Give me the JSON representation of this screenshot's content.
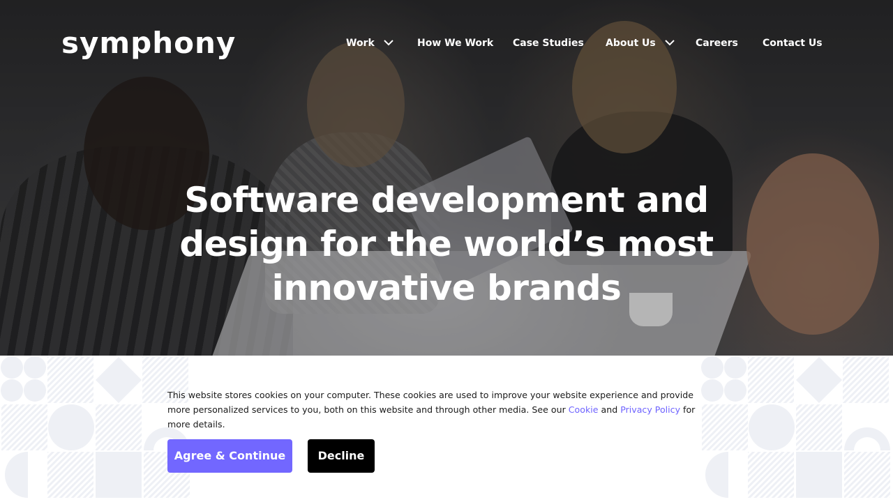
{
  "brand": {
    "logo_text": "symphony"
  },
  "nav": {
    "items": [
      {
        "label": "Work",
        "has_dropdown": true
      },
      {
        "label": "How We Work",
        "has_dropdown": false
      },
      {
        "label": "Case Studies",
        "has_dropdown": false
      },
      {
        "label": "About Us",
        "has_dropdown": true
      },
      {
        "label": "Careers",
        "has_dropdown": false
      },
      {
        "label": "Contact Us",
        "has_dropdown": false
      }
    ]
  },
  "hero": {
    "headline_line1": "Software development and",
    "headline_line2": "design for the world’s most",
    "headline_line3": "innovative brands"
  },
  "cookie_banner": {
    "text_before": "This website stores cookies on your computer. These cookies are used to improve your website experience and provide more personalized services to you, both on this website and through other media. See our ",
    "cookie_link": "Cookie",
    "text_and": " and ",
    "privacy_link": "Privacy Policy",
    "text_after": " for more details.",
    "agree_label": "Agree & Continue",
    "decline_label": "Decline"
  },
  "colors": {
    "accent": "#7267ff",
    "link": "#6e63ff",
    "decline_bg": "#000000",
    "text_white": "#ffffff",
    "pattern": "#eef0f5"
  }
}
